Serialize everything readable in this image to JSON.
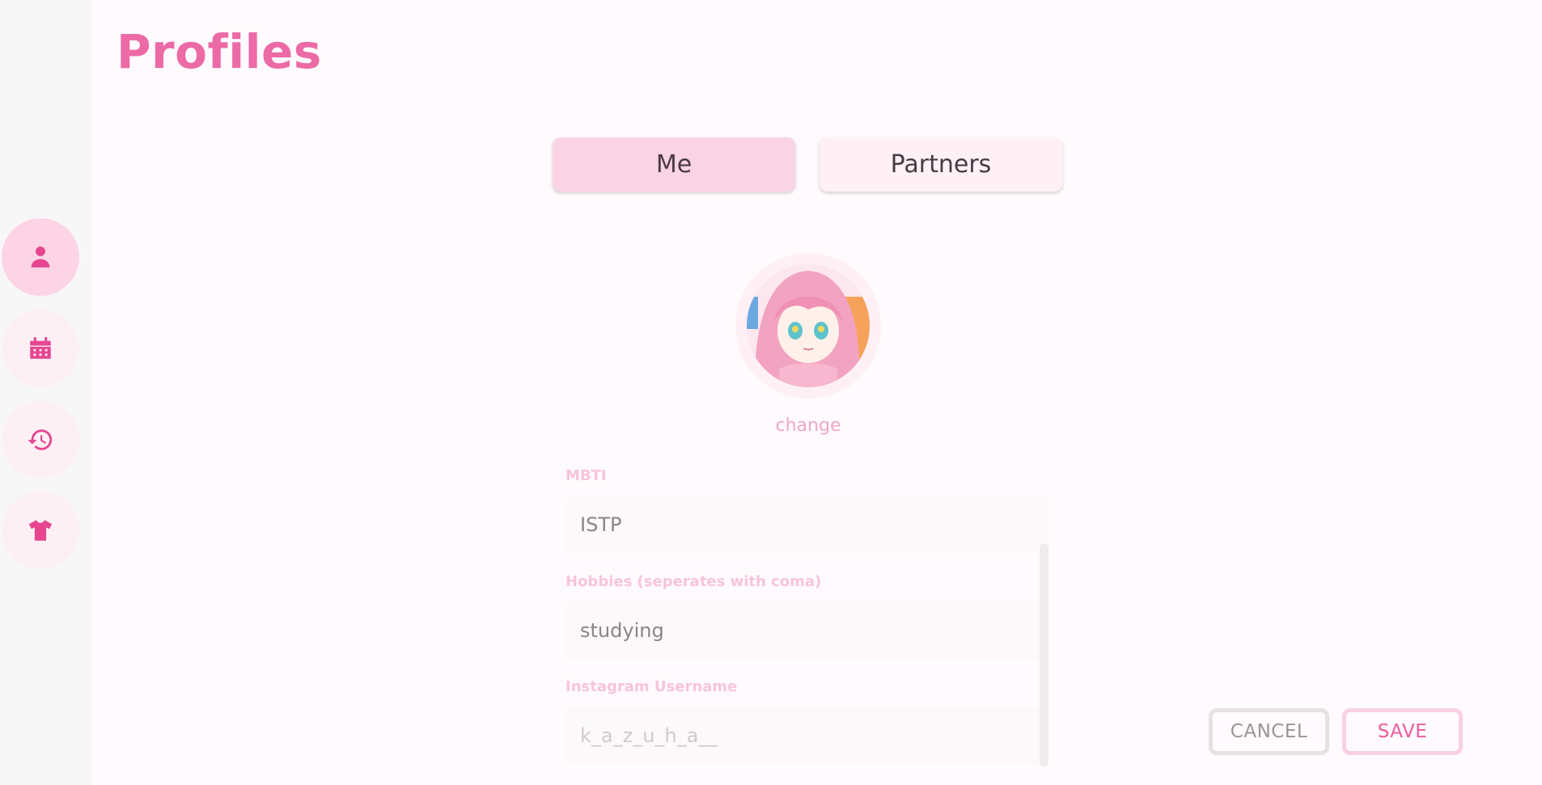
{
  "page": {
    "title": "Profiles"
  },
  "sidebar": {
    "items": [
      {
        "name": "profile",
        "icon": "person-icon",
        "active": true
      },
      {
        "name": "calendar",
        "icon": "calendar-icon",
        "active": false
      },
      {
        "name": "history",
        "icon": "history-icon",
        "active": false
      },
      {
        "name": "outfits",
        "icon": "tshirt-icon",
        "active": false
      }
    ]
  },
  "tabs": [
    {
      "label": "Me",
      "active": true
    },
    {
      "label": "Partners",
      "active": false
    }
  ],
  "profile": {
    "change_label": "change",
    "fields": {
      "mbti": {
        "label": "MBTI",
        "value": "ISTP",
        "placeholder": ""
      },
      "hobbies": {
        "label": "Hobbies (seperates with coma)",
        "value": "studying",
        "placeholder": ""
      },
      "instagram": {
        "label": "Instagram Username",
        "value": "",
        "placeholder": "k_a_z_u_h_a__"
      }
    }
  },
  "actions": {
    "cancel_label": "CANCEL",
    "save_label": "SAVE"
  },
  "colors": {
    "accent": "#ec6aa6",
    "nav_active_bg": "#fcd4e6",
    "nav_icon": "#e74590",
    "tab_active_bg": "#fad3e5"
  }
}
